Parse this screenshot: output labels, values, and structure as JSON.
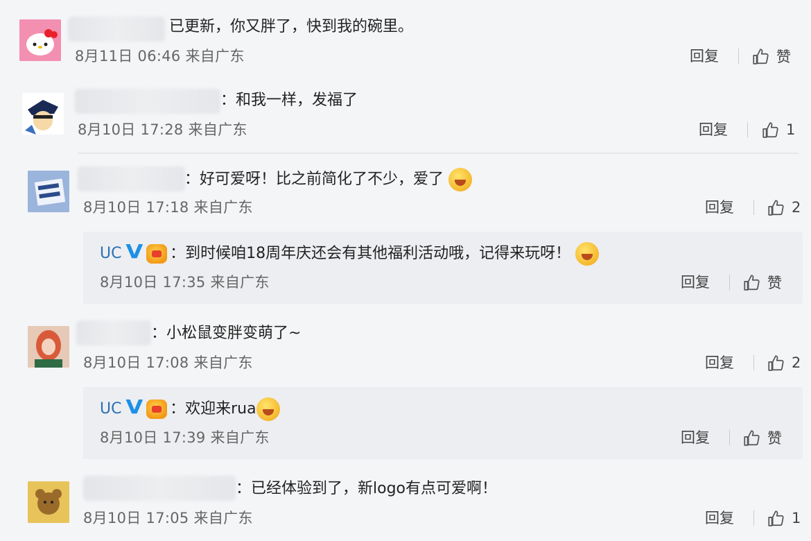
{
  "comments": [
    {
      "text": "已更新，你又胖了，快到我的碗里。",
      "time": "8月11日 06:46 来自广东",
      "reply": "回复",
      "like": "赞"
    },
    {
      "text": "：和我一样，发福了",
      "time": "8月10日 17:28 来自广东",
      "reply": "回复",
      "like": "1"
    },
    {
      "text": "：好可爱呀！比之前简化了不少，爱了",
      "time": "8月10日 17:18 来自广东",
      "reply": "回复",
      "like": "2"
    },
    {
      "text": "：小松鼠变胖变萌了~",
      "time": "8月10日 17:08 来自广东",
      "reply": "回复",
      "like": "2"
    },
    {
      "text": "：已经体验到了，新logo有点可爱啊！",
      "time": "8月10日 17:05 来自广东",
      "reply": "回复",
      "like": "1"
    }
  ],
  "replies": [
    {
      "name": "UC",
      "verified": "V",
      "text": "：到时候咱18周年庆还会有其他福利活动哦，记得来玩呀！",
      "time": "8月10日 17:35 来自广东",
      "reply": "回复",
      "like": "赞"
    },
    {
      "name": "UC",
      "verified": "V",
      "text": "：欢迎来rua",
      "time": "8月10日 17:39 来自广东",
      "reply": "回复",
      "like": "赞"
    }
  ],
  "icons": {
    "like": "thumbs-up-icon",
    "emoji": "emoji-icon",
    "verified": "verified-v-icon"
  },
  "colors": {
    "background": "#f4f5f7",
    "reply_background": "#eceef1",
    "uc_name": "#2b6fb6",
    "verified": "#1e90e6"
  }
}
